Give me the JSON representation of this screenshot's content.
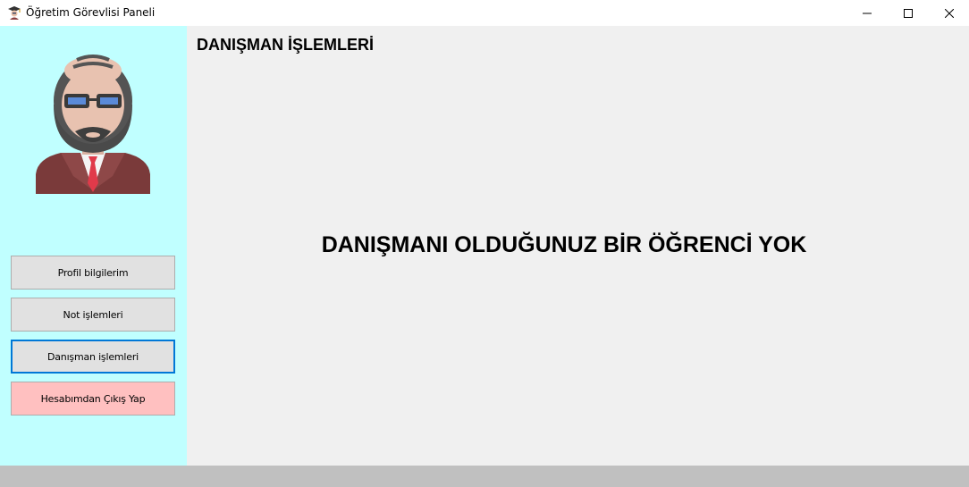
{
  "window": {
    "title": "Öğretim Görevlisi Paneli",
    "app_icon": "graduate-cap-icon"
  },
  "sidebar": {
    "avatar_icon": "teacher-avatar-icon",
    "buttons": [
      {
        "label": "Profil bilgilerim",
        "state": "normal"
      },
      {
        "label": "Not işlemleri",
        "state": "normal"
      },
      {
        "label": "Danışman işlemleri",
        "state": "active"
      },
      {
        "label": "Hesabımdan Çıkış Yap",
        "state": "danger"
      }
    ]
  },
  "main": {
    "section_title": "DANIŞMAN İŞLEMLERİ",
    "empty_message": "DANIŞMANI OLDUĞUNUZ BİR ÖĞRENCİ YOK"
  },
  "colors": {
    "sidebar_bg": "#c0ffff",
    "content_bg": "#f0f0f0",
    "active_border": "#0078d7",
    "logout_bg": "#ffc0c0",
    "status_bar": "#c0c0c0"
  }
}
